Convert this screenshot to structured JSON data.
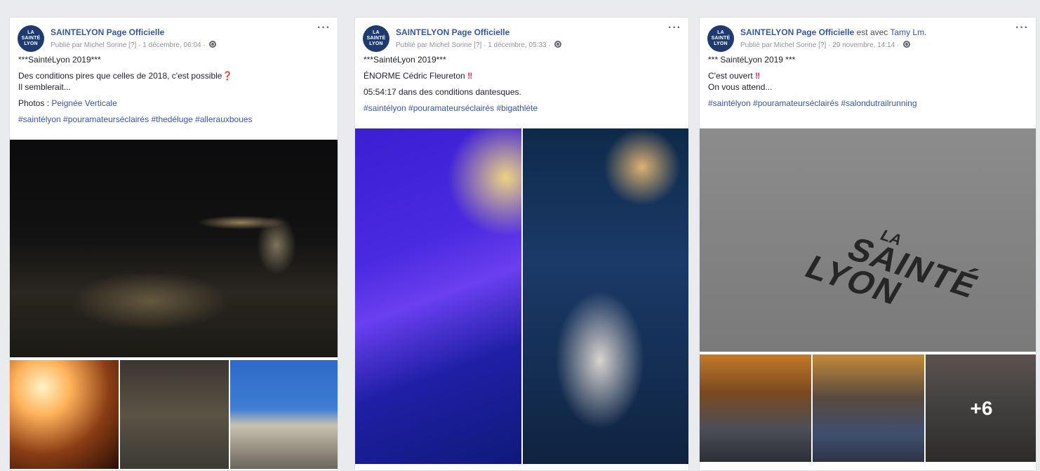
{
  "posts": [
    {
      "avatar_lines": [
        "LA",
        "SAINTÉ",
        "LYON"
      ],
      "page_name": "SAINTELYON Page Officielle",
      "with_text": "",
      "with_name": "",
      "published_by": "Publié par Michel Sorine",
      "help_marker": "[?]",
      "date": "1 décembre, 06:04",
      "more": "···",
      "lines": [
        "***SaintéLyon 2019***",
        "Des conditions pires que celles de 2018, c'est possible",
        "Il semblerait...",
        "Photos : "
      ],
      "photos_link": "Peignée Verticale",
      "hashtags": "#saintélyon #pouramateurséclairés #thedéluge #allerauxboues"
    },
    {
      "avatar_lines": [
        "LA",
        "SAINTÉ",
        "LYON"
      ],
      "page_name": "SAINTELYON Page Officielle",
      "with_text": "",
      "with_name": "",
      "published_by": "Publié par Michel Sorine",
      "help_marker": "[?]",
      "date": "1 décembre, 05:33",
      "more": "···",
      "lines": [
        "***SaintéLyon 2019***",
        "ÉNORME Cédric Fleureton",
        "05:54:17 dans des conditions dantesques."
      ],
      "hashtags": "#saintélyon #pouramateurséclairés #bigathlète"
    },
    {
      "avatar_lines": [
        "LA",
        "SAINTÉ",
        "LYON"
      ],
      "page_name": "SAINTELYON Page Officielle",
      "with_text": " est avec ",
      "with_name": "Tamy Lm.",
      "published_by": "Publié par Michel Sorine",
      "help_marker": "[?]",
      "date": "29 novembre, 14:14",
      "more": "···",
      "lines": [
        "*** SaintéLyon 2019 ***",
        "C'est ouvert",
        "On vous attend..."
      ],
      "hashtags": "#saintélyon #pouramateurséclairés #salondutrailrunning",
      "more_photos": "+6",
      "ground_logo": [
        "LA",
        "SAINTÉ",
        "LYON"
      ]
    }
  ],
  "emoji": {
    "question": "❓",
    "double_bang": "‼"
  },
  "colors": {
    "link": "#385898",
    "meta": "#90949c",
    "background": "#e9ebee"
  }
}
